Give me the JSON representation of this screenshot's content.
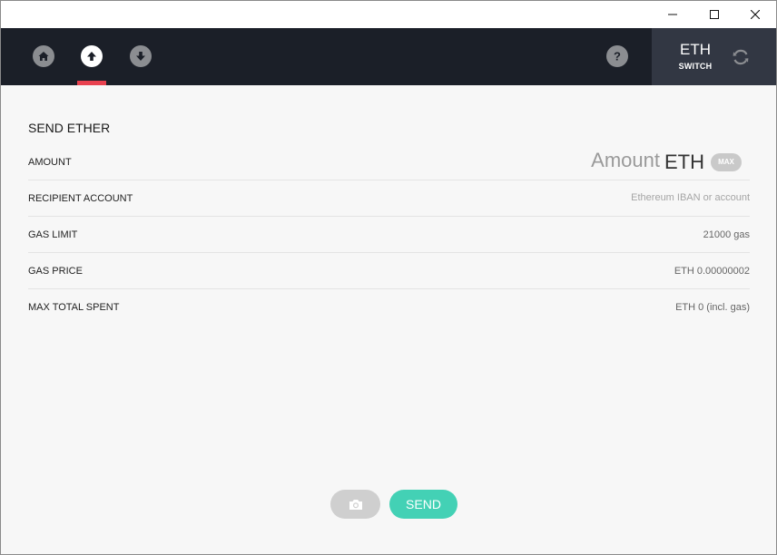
{
  "window": {
    "controls": {
      "minimize_icon": "minimize-icon",
      "maximize_icon": "maximize-icon",
      "close_icon": "close-icon"
    }
  },
  "nav": {
    "items": [
      {
        "id": "home",
        "icon": "home-icon",
        "active": false
      },
      {
        "id": "send",
        "icon": "arrow-up-icon",
        "active": true
      },
      {
        "id": "receive",
        "icon": "arrow-down-icon",
        "active": false
      }
    ],
    "help_icon": "question-icon",
    "currency": "ETH",
    "switch_label": "SWITCH",
    "switch_icon": "refresh-icon"
  },
  "form": {
    "title": "SEND ETHER",
    "amount": {
      "label": "AMOUNT",
      "placeholder": "Amount",
      "unit": "ETH",
      "max_label": "MAX"
    },
    "recipient": {
      "label": "RECIPIENT ACCOUNT",
      "placeholder": "Ethereum IBAN or account"
    },
    "gas_limit": {
      "label": "GAS LIMIT",
      "value": "21000 gas"
    },
    "gas_price": {
      "label": "GAS PRICE",
      "value": "ETH 0.00000002"
    },
    "max_total": {
      "label": "MAX TOTAL SPENT",
      "value": "ETH 0 (incl. gas)"
    }
  },
  "actions": {
    "camera_icon": "camera-icon",
    "send_label": "SEND"
  },
  "colors": {
    "navbar": "#1b1f28",
    "switch_panel": "#323743",
    "active_indicator": "#e8414f",
    "send_button": "#43d1b5",
    "background": "#f7f7f7"
  }
}
